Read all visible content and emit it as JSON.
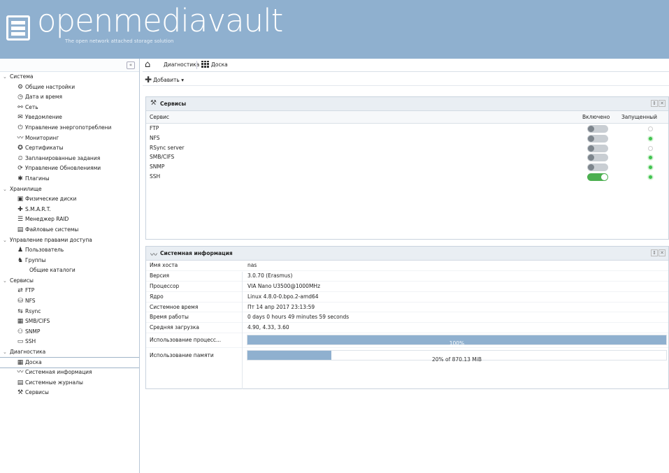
{
  "header": {
    "logo_text": "openmediavault",
    "logo_sub": "The open network attached storage solution"
  },
  "sidebar": {
    "collapse_icon": "«",
    "nodes": [
      {
        "t": "grp",
        "label": "Система"
      },
      {
        "t": "item",
        "icon": "⚙",
        "label": "Общие настройки",
        "name": "general-settings"
      },
      {
        "t": "item",
        "icon": "◷",
        "label": "Дата и время",
        "name": "date-time"
      },
      {
        "t": "item",
        "icon": "⚯",
        "label": "Сеть",
        "name": "network"
      },
      {
        "t": "item",
        "icon": "✉",
        "label": "Уведомление",
        "name": "notification"
      },
      {
        "t": "item",
        "icon": "⏻",
        "label": "Управление энергопотреблени",
        "name": "power-management"
      },
      {
        "t": "item",
        "icon": "〰",
        "label": "Мониторинг",
        "name": "monitoring"
      },
      {
        "t": "item",
        "icon": "✪",
        "label": "Сертификаты",
        "name": "certificates"
      },
      {
        "t": "item",
        "icon": "⏲",
        "label": "Запланированные задания",
        "name": "scheduled-jobs"
      },
      {
        "t": "item",
        "icon": "⟳",
        "label": "Управление Обновлениями",
        "name": "update-management"
      },
      {
        "t": "item",
        "icon": "✱",
        "label": "Плагины",
        "name": "plugins"
      },
      {
        "t": "grp",
        "label": "Хранилище"
      },
      {
        "t": "item",
        "icon": "▣",
        "label": "Физические диски",
        "name": "physical-disks"
      },
      {
        "t": "item",
        "icon": "✚",
        "label": "S.M.A.R.T.",
        "name": "smart"
      },
      {
        "t": "item",
        "icon": "☰",
        "label": "Менеджер RAID",
        "name": "raid-manager"
      },
      {
        "t": "item",
        "icon": "▤",
        "label": "Файловые системы",
        "name": "file-systems"
      },
      {
        "t": "grp",
        "label": "Управление правами доступа"
      },
      {
        "t": "item",
        "icon": "♟",
        "label": "Пользователь",
        "name": "user"
      },
      {
        "t": "item",
        "icon": "♞",
        "label": "Группы",
        "name": "groups"
      },
      {
        "t": "nic",
        "label": "Общие каталоги",
        "name": "shared-folders"
      },
      {
        "t": "grp",
        "label": "Сервисы"
      },
      {
        "t": "item",
        "icon": "⇄",
        "label": "FTP",
        "name": "ftp"
      },
      {
        "t": "item",
        "icon": "⛁",
        "label": "NFS",
        "name": "nfs"
      },
      {
        "t": "item",
        "icon": "⇆",
        "label": "Rsync",
        "name": "rsync"
      },
      {
        "t": "item",
        "icon": "▦",
        "label": "SMB/CIFS",
        "name": "smb-cifs"
      },
      {
        "t": "item",
        "icon": "⚇",
        "label": "SNMP",
        "name": "snmp"
      },
      {
        "t": "item",
        "icon": "▭",
        "label": "SSH",
        "name": "ssh"
      },
      {
        "t": "grp",
        "label": "Диагностика"
      },
      {
        "t": "item",
        "icon": "▦",
        "label": "Доска",
        "name": "dashboard",
        "sel": true
      },
      {
        "t": "item",
        "icon": "〰",
        "label": "Системная информация",
        "name": "system-information"
      },
      {
        "t": "item",
        "icon": "▤",
        "label": "Системные журналы",
        "name": "system-logs"
      },
      {
        "t": "item",
        "icon": "⚒",
        "label": "Сервисы",
        "name": "services"
      }
    ]
  },
  "tabs": {
    "home_icon": "⌂",
    "tab1": "Диагностика",
    "tab2": "Доска"
  },
  "toolbar": {
    "add_icon": "✚",
    "add_label": "Добавить ▾"
  },
  "services_panel": {
    "icon": "⚒",
    "title": "Сервисы",
    "tool_icons": [
      "⇕",
      "✕"
    ],
    "col_service": "Сервис",
    "col_enabled": "Включено",
    "col_running": "Запущенный",
    "rows": [
      {
        "name": "FTP",
        "enabled": false,
        "running": false
      },
      {
        "name": "NFS",
        "enabled": false,
        "running": true
      },
      {
        "name": "RSync server",
        "enabled": false,
        "running": false
      },
      {
        "name": "SMB/CIFS",
        "enabled": false,
        "running": true
      },
      {
        "name": "SNMP",
        "enabled": false,
        "running": true
      },
      {
        "name": "SSH",
        "enabled": true,
        "running": true
      }
    ]
  },
  "sysinfo_panel": {
    "icon": "〰",
    "title": "Системная информация",
    "tool_icons": [
      "⇕",
      "✕"
    ],
    "rows": [
      {
        "k": "Имя хоста",
        "v": "nas"
      },
      {
        "k": "Версия",
        "v": "3.0.70 (Erasmus)"
      },
      {
        "k": "Процессор",
        "v": "VIA Nano U3500@1000MHz"
      },
      {
        "k": "Ядро",
        "v": "Linux 4.8.0-0.bpo.2-amd64"
      },
      {
        "k": "Системное время",
        "v": "Пт 14 апр 2017 23:13:59"
      },
      {
        "k": "Время работы",
        "v": "0 days 0 hours 49 minutes 59 seconds"
      },
      {
        "k": "Средняя загрузка",
        "v": "4.90, 4.33, 3.60"
      }
    ],
    "cpu_label": "Использование процесс...",
    "cpu_value": "100%",
    "cpu_fraction": 1.0,
    "mem_label": "Использование памяти",
    "mem_value": "20% of 870.13 MiB",
    "mem_fraction": 0.2
  }
}
